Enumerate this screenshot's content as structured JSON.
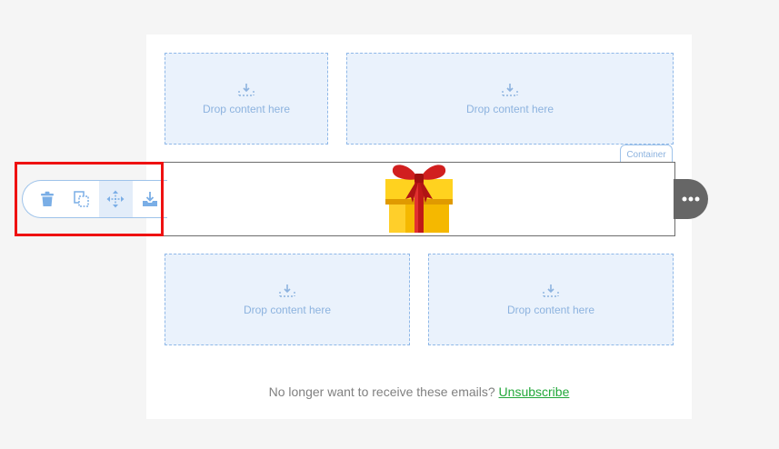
{
  "drop_zone_label": "Drop content here",
  "container_tag": "Container",
  "toolbar": {
    "icons": [
      "delete-icon",
      "duplicate-icon",
      "move-icon",
      "save-icon"
    ],
    "active": "move-icon"
  },
  "more_icon": "ellipsis-icon",
  "footer": {
    "text": "No longer want to receive these emails?",
    "link": "Unsubscribe"
  },
  "colors": {
    "accent": "#8db3df",
    "highlight": "#ee1111",
    "link": "#22a83a"
  }
}
